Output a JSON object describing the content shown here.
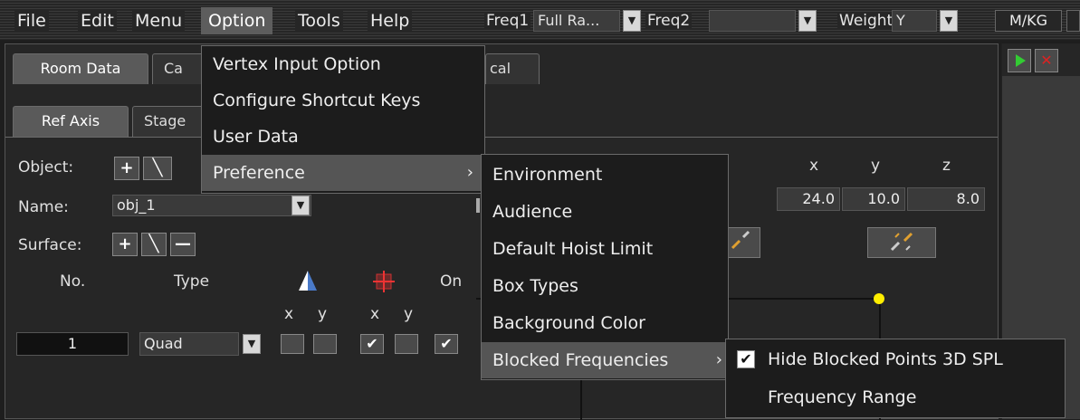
{
  "menubar": {
    "items": [
      "File",
      "Edit",
      "Menu",
      "Option",
      "Tools",
      "Help"
    ],
    "freq1_label": "Freq1",
    "freq1_value": "Full Ra...",
    "freq2_label": "Freq2",
    "freq2_value": "",
    "weight_label": "Weight",
    "weight_value": "Y",
    "unit_button": "M/KG"
  },
  "tabs": {
    "top": [
      "Room Data",
      "Ca",
      "cal"
    ],
    "second": [
      "Ref Axis",
      "Stage"
    ]
  },
  "form": {
    "object_label": "Object:",
    "name_label": "Name:",
    "name_value": "obj_1",
    "surface_label": "Surface:",
    "col_no": "No.",
    "col_type": "Type",
    "col_on": "On",
    "axis_x": "x",
    "axis_y": "y",
    "row_no": "1",
    "row_type": "Quad"
  },
  "coords": {
    "x_label": "x",
    "y_label": "y",
    "z_label": "z",
    "x_value": "24.0",
    "y_value": "10.0",
    "z_value": "8.0"
  },
  "option_menu": {
    "items": [
      "Vertex Input Option",
      "Configure Shortcut Keys",
      "User Data",
      "Preference"
    ]
  },
  "preference_menu": {
    "items": [
      "Environment",
      "Audience",
      "Default Hoist Limit",
      "Box Types",
      "Background Color",
      "Blocked Frequencies"
    ]
  },
  "blocked_menu": {
    "items": [
      "Hide Blocked Points 3D SPL",
      "Frequency Range"
    ],
    "hide_checked": true
  },
  "colors": {
    "play": "#33cc33",
    "close": "#dd2222",
    "marker": "#ffee00"
  }
}
